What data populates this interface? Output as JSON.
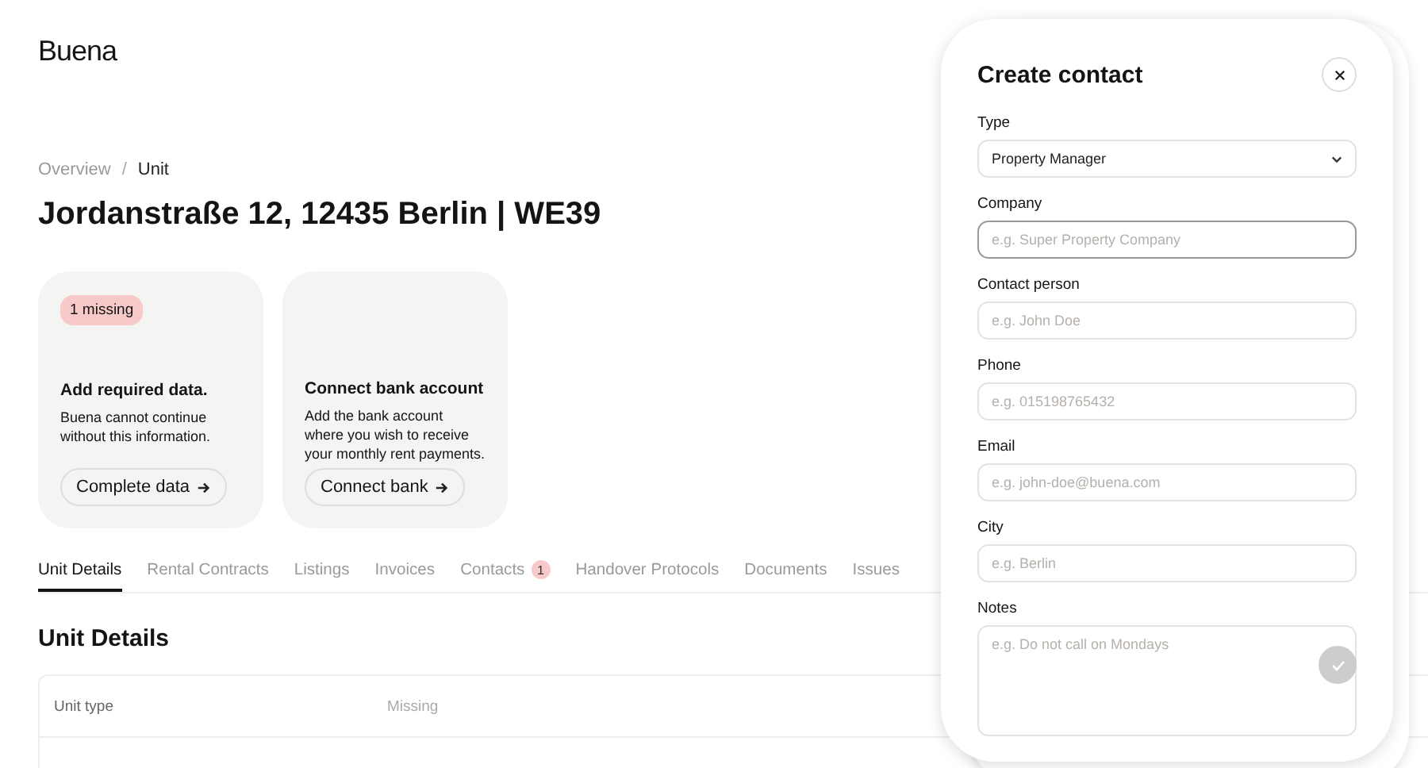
{
  "logo": "Buena",
  "breadcrumb_separator": "/",
  "breadcrumb": [
    {
      "label": "Overview",
      "current": false
    },
    {
      "label": "Unit",
      "current": true
    }
  ],
  "title": "Jordanstraße 12, 12435 Berlin | WE39",
  "cards": [
    {
      "badge": "1 missing",
      "heading": "Add required data.",
      "text": "Buena cannot continue without this information.",
      "button": "Complete data"
    },
    {
      "heading": "Connect bank account",
      "text": "Add the bank account where you wish to receive your monthly rent payments.",
      "button": "Connect bank"
    }
  ],
  "tabs": [
    {
      "label": "Unit Details",
      "selected": true
    },
    {
      "label": "Rental Contracts",
      "selected": false
    },
    {
      "label": "Listings",
      "selected": false
    },
    {
      "label": "Invoices",
      "selected": false
    },
    {
      "label": "Contacts",
      "selected": false,
      "count": "1"
    },
    {
      "label": "Handover Protocols",
      "selected": false
    },
    {
      "label": "Documents",
      "selected": false
    },
    {
      "label": "Issues",
      "selected": false
    }
  ],
  "section_title": "Unit Details",
  "table": {
    "rows": [
      {
        "label": "Unit type",
        "value": "Missing",
        "missing": true
      }
    ]
  },
  "dialog": {
    "title": "Create contact",
    "fields": [
      {
        "kind": "select",
        "label": "Type",
        "value": "Property Manager"
      },
      {
        "kind": "input",
        "label": "Company",
        "placeholder": "e.g. Super Property Company",
        "focused": true
      },
      {
        "kind": "input",
        "label": "Contact person",
        "placeholder": "e.g. John Doe",
        "focused": false
      },
      {
        "kind": "input",
        "label": "Phone",
        "placeholder": "e.g. 015198765432",
        "focused": false
      },
      {
        "kind": "input",
        "label": "Email",
        "placeholder": "e.g. john-doe@buena.com",
        "focused": false
      },
      {
        "kind": "input",
        "label": "City",
        "placeholder": "e.g. Berlin",
        "focused": false
      },
      {
        "kind": "textarea",
        "label": "Notes",
        "placeholder": "e.g. Do not call on Mondays",
        "focused": false
      }
    ],
    "submit": {
      "disabled": true
    }
  }
}
